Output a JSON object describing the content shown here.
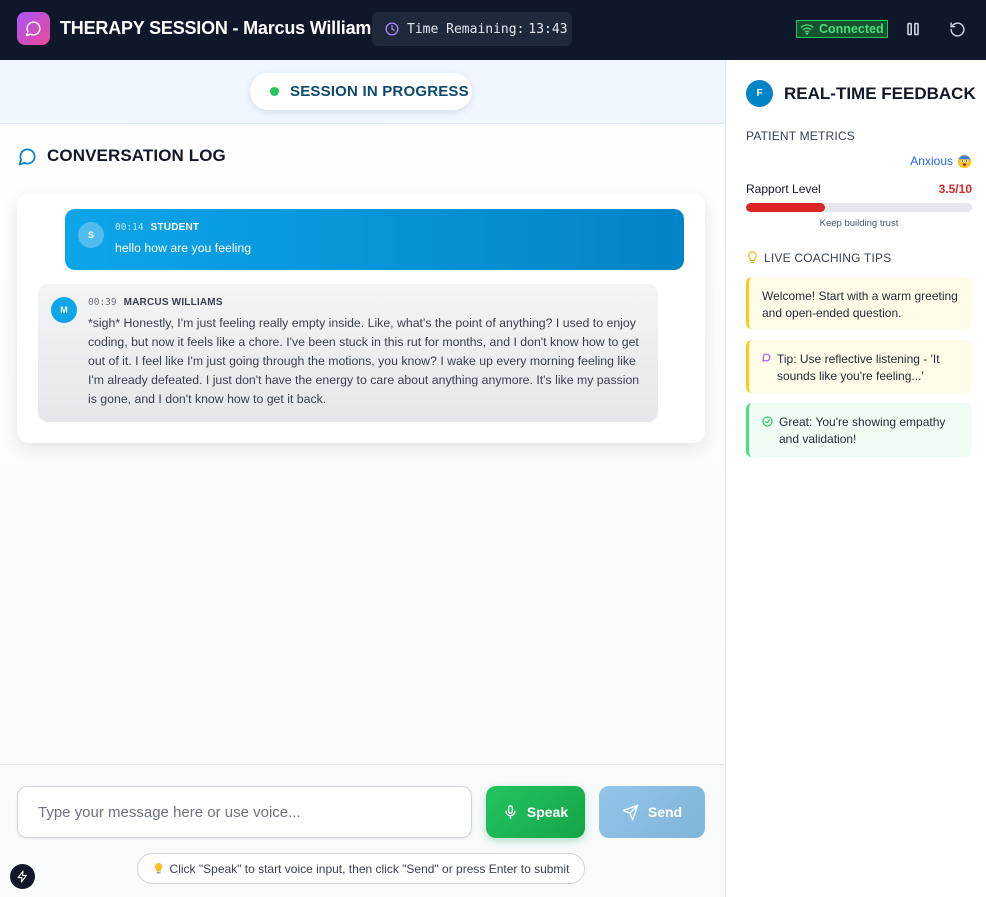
{
  "header": {
    "title": "THERAPY SESSION - Marcus Williams",
    "timer_label": "Time Remaining:",
    "timer_value": "13:43",
    "connection": "Connected"
  },
  "session": {
    "status": "SESSION IN PROGRESS",
    "log_title": "CONVERSATION LOG",
    "messages": [
      {
        "avatar": "S",
        "time": "00:14",
        "sender": "STUDENT",
        "text": "hello how are you feeling"
      },
      {
        "avatar": "M",
        "time": "00:39",
        "sender": "MARCUS WILLIAMS",
        "text": "*sigh* Honestly, I'm just feeling really empty inside. Like, what's the point of anything? I used to enjoy coding, but now it feels like a chore. I've been stuck in this rut for months, and I don't know how to get out of it. I feel like I'm just going through the motions, you know? I wake up every morning feeling like I'm already defeated. I just don't have the energy to care about anything anymore. It's like my passion is gone, and I don't know how to get it back."
      }
    ]
  },
  "composer": {
    "placeholder": "Type your message here or use voice...",
    "speak_label": "Speak",
    "send_label": "Send",
    "hint": "Click \"Speak\" to start voice input, then click \"Send\" or press Enter to submit"
  },
  "feedback": {
    "avatar": "F",
    "title": "REAL-TIME FEEDBACK",
    "metrics_label": "PATIENT METRICS",
    "mood": "Anxious",
    "rapport_label": "Rapport Level",
    "rapport_value": "3.5/10",
    "rapport_fraction": 0.35,
    "rapport_note": "Keep building trust",
    "tips_label": "LIVE COACHING TIPS",
    "tips": [
      {
        "type": "info",
        "text": "Welcome! Start with a warm greeting and open-ended question."
      },
      {
        "type": "tip",
        "text": "Tip: Use reflective listening - 'It sounds like you're feeling...'"
      },
      {
        "type": "good",
        "text": "Great: You're showing empathy and validation!"
      }
    ]
  },
  "colors": {
    "header_bg": "#0f172a",
    "accent": "#0ea5e9",
    "speak": "#22c55e",
    "rapport": "#dc2626",
    "connected": "#4ade80"
  }
}
